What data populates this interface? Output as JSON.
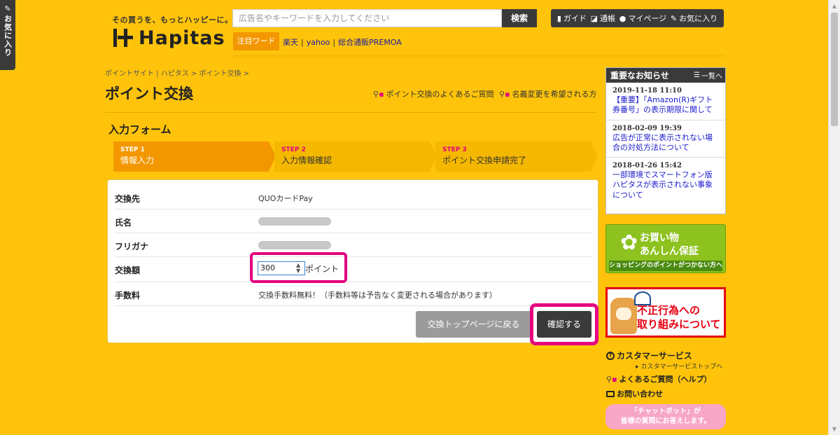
{
  "sidebar_tab": {
    "label": "お気に入り"
  },
  "header": {
    "tagline": "その買うを、もっとハッピーに。",
    "logo_text": "Hapitas",
    "search": {
      "placeholder": "広告名やキーワードを入力してください",
      "button": "検索"
    },
    "hot_label": "注目ワード",
    "hot_links": [
      "楽天",
      "yahoo",
      "総合通販PREMOA"
    ],
    "nav": [
      {
        "label": "ガイド",
        "icon": "book-icon"
      },
      {
        "label": "通帳",
        "icon": "passbook-icon"
      },
      {
        "label": "マイページ",
        "icon": "user-icon"
      },
      {
        "label": "お気に入り",
        "icon": "clip-icon"
      }
    ]
  },
  "breadcrumb": "ポイントサイト | ハピタス > ポイント交換 >",
  "page_title": "ポイント交換",
  "links": {
    "faq": "ポイント交換のよくあるご質問",
    "rename": "名義変更を希望される方"
  },
  "form": {
    "title": "入力フォーム",
    "steps": [
      {
        "num": "STEP 1",
        "label": "情報入力",
        "active": true
      },
      {
        "num": "STEP 2",
        "label": "入力情報確認",
        "active": false
      },
      {
        "num": "STEP 3",
        "label": "ポイント交換申請完了",
        "active": false
      }
    ],
    "rows": {
      "destination": {
        "label": "交換先",
        "value": "QUOカードPay"
      },
      "name": {
        "label": "氏名"
      },
      "furigana": {
        "label": "フリガナ"
      },
      "amount": {
        "label": "交換額",
        "value": "300",
        "unit": "ポイント"
      },
      "fee": {
        "label": "手数料",
        "value": "交換手数料無料！（手数料等は予告なく変更される場合があります）"
      }
    },
    "back_button": "交換トップページに戻る",
    "confirm_button": "確認する"
  },
  "news": {
    "title": "重要なお知らせ",
    "all_label": "一覧へ",
    "items": [
      {
        "date": "2019-11-18 11:10",
        "text": "【重要】「Amazon(R)ギフト券番号」の表示期限に関して"
      },
      {
        "date": "2018-02-09 19:39",
        "text": "広告が正常に表示されない場合の対処方法について"
      },
      {
        "date": "2018-01-26 15:42",
        "text": "一部環境でスマートフォン版ハピタスが表示されない事象について"
      }
    ]
  },
  "banners": {
    "shop": {
      "line1": "お買い物",
      "line2": "あんしん保証",
      "bar": "ショッピングのポイントがつかない方へ"
    },
    "fraud": {
      "line1": "不正行為への",
      "line2": "取り組みについて"
    }
  },
  "support": {
    "title": "カスタマーサービス",
    "sub": "カスタマーサービストップへ",
    "faq": "よくあるご質問（ヘルプ）",
    "contact": "お問い合わせ",
    "chatbot_line1": "「チャットボット」が",
    "chatbot_line2": "皆様の質問にお答えします。"
  },
  "colors": {
    "background": "#fec30a",
    "accent": "#f39700",
    "highlight": "#e4007f",
    "dark": "#3a3a3a"
  }
}
